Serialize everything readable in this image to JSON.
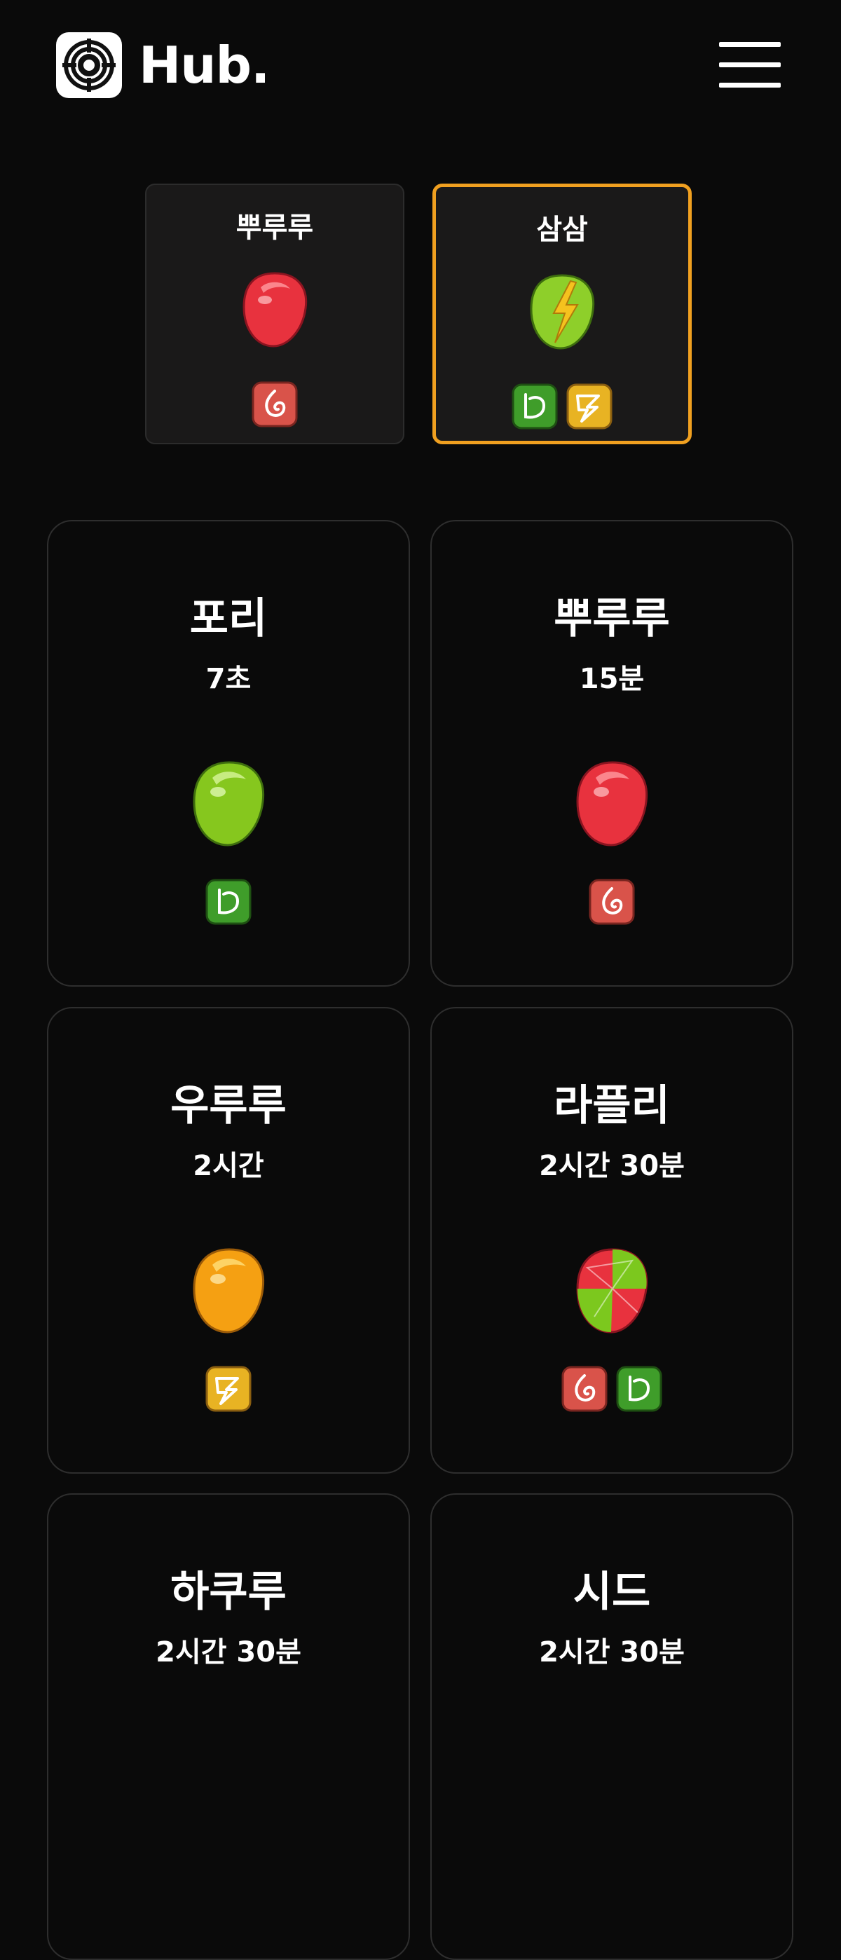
{
  "header": {
    "brand": "Hub.",
    "logo_icon": "target-maze-icon",
    "menu_icon": "hamburger-menu-icon"
  },
  "colors": {
    "background": "#0a0a0a",
    "selected_border": "#f0a020",
    "fire": "#d9534a",
    "grass": "#3f9d2a",
    "electric": "#e8b323"
  },
  "selected": [
    {
      "name": "뿌루루",
      "gem": "red",
      "types": [
        "fire"
      ],
      "active": false
    },
    {
      "name": "삼삼",
      "gem": "green-electric",
      "types": [
        "grass",
        "electric"
      ],
      "active": true
    }
  ],
  "cards": [
    {
      "name": "포리",
      "time": "7초",
      "gem": "green",
      "types": [
        "grass"
      ]
    },
    {
      "name": "뿌루루",
      "time": "15분",
      "gem": "red",
      "types": [
        "fire"
      ]
    },
    {
      "name": "우루루",
      "time": "2시간",
      "gem": "orange",
      "types": [
        "electric"
      ]
    },
    {
      "name": "라플리",
      "time": "2시간 30분",
      "gem": "red-green",
      "types": [
        "fire",
        "grass"
      ]
    },
    {
      "name": "하쿠루",
      "time": "2시간 30분",
      "gem": "",
      "types": []
    },
    {
      "name": "시드",
      "time": "2시간 30분",
      "gem": "",
      "types": []
    }
  ]
}
